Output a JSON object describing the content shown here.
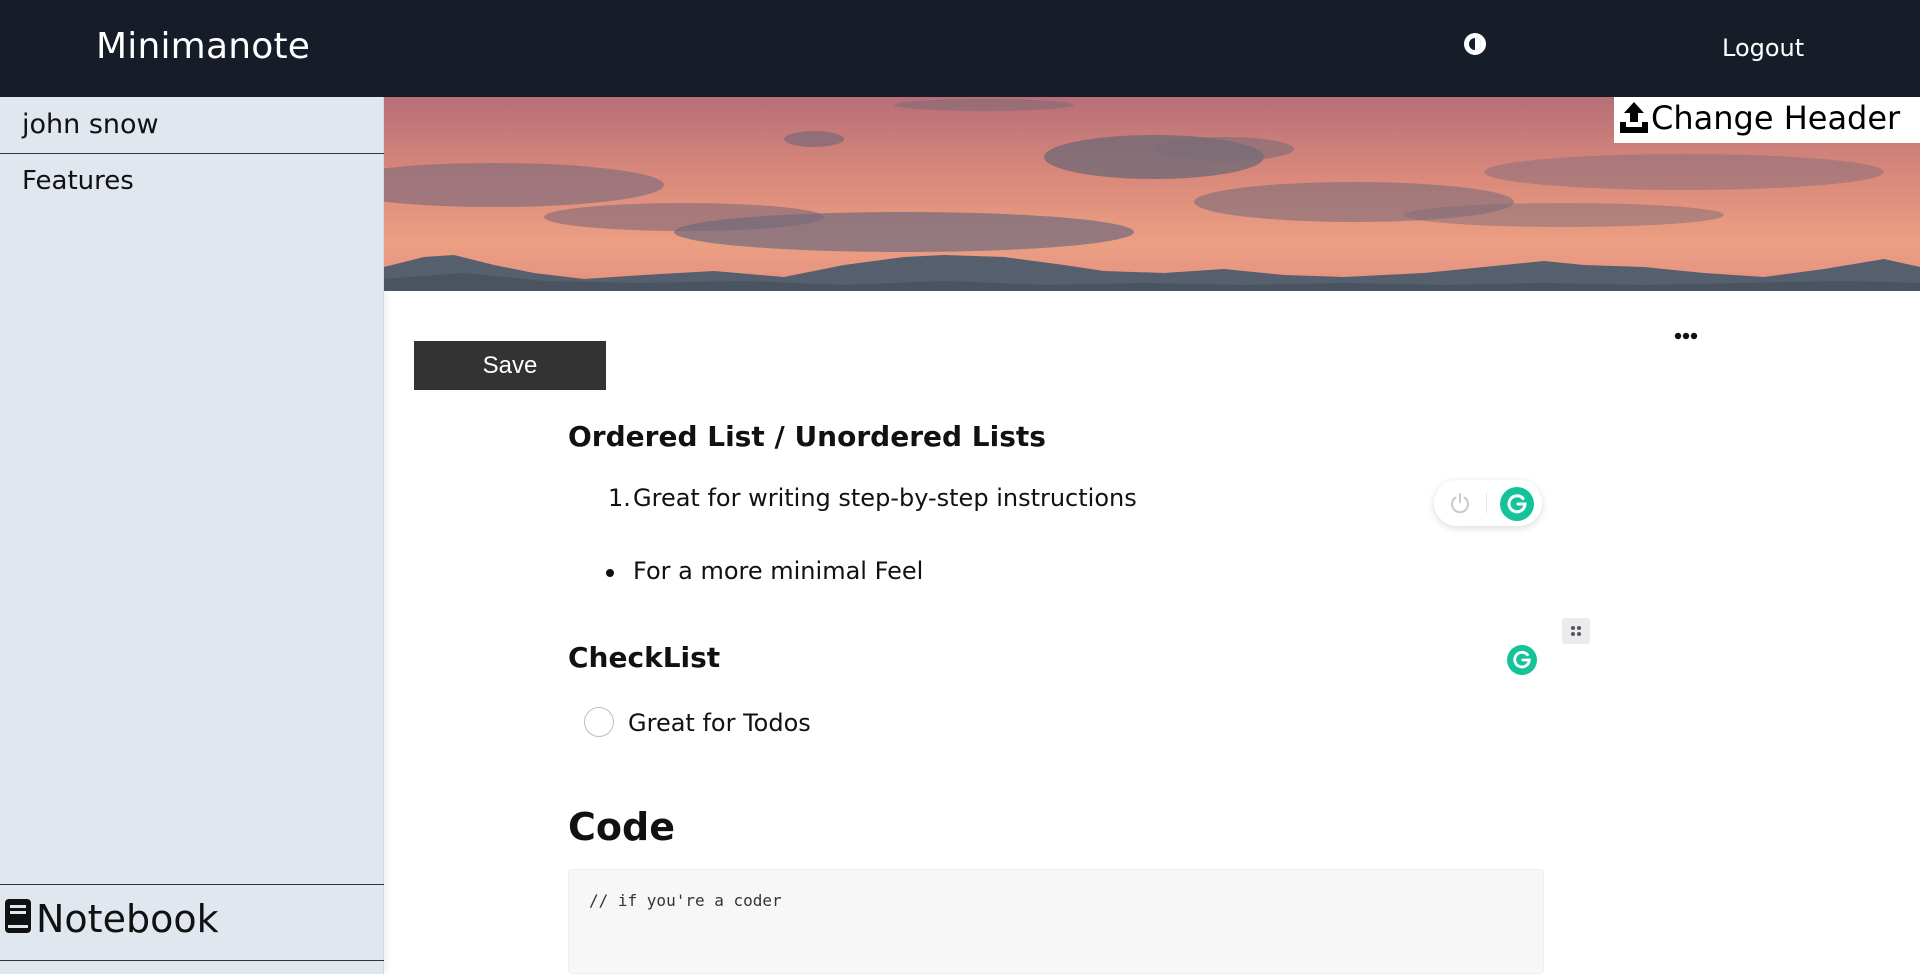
{
  "app": {
    "title": "Minimanote",
    "logout_label": "Logout",
    "theme_toggle_icon": "contrast-icon"
  },
  "sidebar": {
    "user_name": "john snow",
    "items": [
      {
        "label": "Features"
      }
    ],
    "bottom": {
      "icon": "book-icon",
      "label": "Notebook"
    }
  },
  "header": {
    "change_header_label": "Change Header",
    "change_header_icon": "upload-icon"
  },
  "editor": {
    "save_label": "Save",
    "more_icon": "more-horizontal-icon",
    "blocks": {
      "ordered_heading": "Ordered List / Unordered Lists",
      "ordered_items": [
        {
          "number": "1.",
          "text": "Great for writing step-by-step instructions"
        }
      ],
      "unordered_items": [
        {
          "text": "For a more minimal Feel"
        }
      ],
      "checklist_heading": "CheckList",
      "checklist_items": [
        {
          "text": "Great for Todos",
          "checked": false
        }
      ],
      "code_heading": "Code",
      "code_text": "// if you're a coder"
    }
  },
  "colors": {
    "topbar": "#161d28",
    "sidebar": "#e0e7ef",
    "save_button": "#333333",
    "grammarly_green": "#15c39a"
  }
}
